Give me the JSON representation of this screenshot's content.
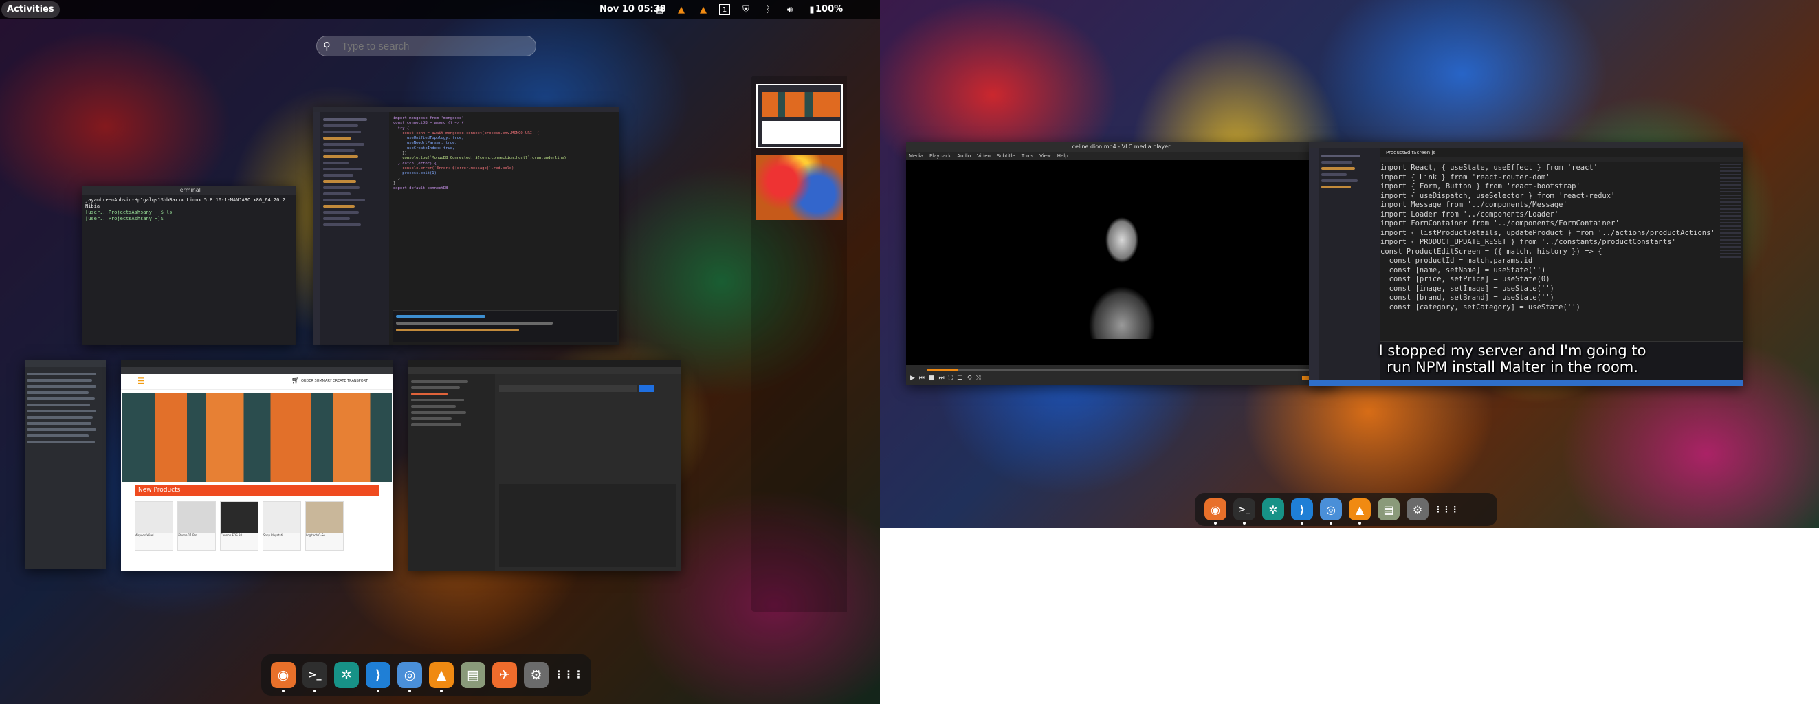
{
  "topbar": {
    "activities": "Activities",
    "clock": "Nov 10  05:38",
    "battery": "100%",
    "workspace_indicator": "1"
  },
  "search": {
    "placeholder": "Type to search"
  },
  "terminal_window": {
    "title": "Terminal",
    "lines": [
      "jayaubreenAubsin-Hp1galqs1ShbBaxxx Linux 5.8.10-1-MANJARO x86_64 20.2 Nibia",
      "[user...ProjectsAshsany ~]$ ls",
      "[user...ProjectsAshsany ~]$ "
    ]
  },
  "vscode_left": {
    "code": [
      "import mongoose from 'mongoose'",
      "",
      "const connectDB = async () => {",
      "  try {",
      "    const conn = await mongoose.connect(process.env.MONGO_URI, {",
      "      useUnifiedTopology: true,",
      "      useNewUrlParser: true,",
      "      useCreateIndex: true,",
      "    })",
      "",
      "    console.log(`MongoDB Connected: ${conn.connection.host}`.cyan.underline)",
      "  } catch (error) {",
      "    console.error(`Error: ${error.message}`.red.bold)",
      "    process.exit(1)",
      "  }",
      "}",
      "",
      "export default connectDB"
    ]
  },
  "shop_window": {
    "cart_label": "ORDER SUMMARY CREATE TRANSPORT",
    "section_title": "New Products",
    "products": [
      "Airpods Wirel...",
      "iPhone 11 Pro",
      "Cannon EOS 80...",
      "Sony Playstati...",
      "Logitech G-Se..."
    ]
  },
  "vlc_window": {
    "title": "celine dion.mp4 - VLC media player",
    "menu": [
      "Media",
      "Playback",
      "Audio",
      "Video",
      "Subtitle",
      "Tools",
      "View",
      "Help"
    ]
  },
  "vscode_right": {
    "tab": "ProductEditScreen.js",
    "code": [
      "import React, { useState, useEffect } from 'react'",
      "import { Link } from 'react-router-dom'",
      "import { Form, Button } from 'react-bootstrap'",
      "import { useDispatch, useSelector } from 'react-redux'",
      "import Message from '../components/Message'",
      "import Loader from '../components/Loader'",
      "import FormContainer from '../components/FormContainer'",
      "import { listProductDetails, updateProduct } from '../actions/productActions'",
      "import { PRODUCT_UPDATE_RESET } from '../constants/productConstants'",
      "",
      "const ProductEditScreen = ({ match, history }) => {",
      "  const productId = match.params.id",
      "",
      "  const [name, setName] = useState('')",
      "  const [price, setPrice] = useState(0)",
      "  const [image, setImage] = useState('')",
      "  const [brand, setBrand] = useState('')",
      "  const [category, setCategory] = useState('')"
    ]
  },
  "subtitle": {
    "line1": "I stopped my server and I'm going to",
    "line2": "run NPM install Malter in the room."
  },
  "dock_left": [
    {
      "name": "firefox",
      "color": "#e8702a",
      "glyph": "◉"
    },
    {
      "name": "terminal",
      "color": "#2e2e2e",
      "glyph": ">_"
    },
    {
      "name": "gitkraken",
      "color": "#179287",
      "glyph": "✲"
    },
    {
      "name": "vscode",
      "color": "#1f7fd6",
      "glyph": "⟩"
    },
    {
      "name": "chromium",
      "color": "#4a8fd8",
      "glyph": "◎"
    },
    {
      "name": "vlc",
      "color": "#f08a12",
      "glyph": "▲"
    },
    {
      "name": "files",
      "color": "#8a9a7a",
      "glyph": "▤"
    },
    {
      "name": "postman",
      "color": "#ef6c2c",
      "glyph": "✈"
    },
    {
      "name": "settings",
      "color": "#6b6b6b",
      "glyph": "⚙"
    },
    {
      "name": "show-apps",
      "color": "transparent",
      "glyph": "⋮⋮⋮"
    }
  ],
  "dock_right": [
    {
      "name": "firefox",
      "color": "#e8702a",
      "glyph": "◉"
    },
    {
      "name": "terminal",
      "color": "#2e2e2e",
      "glyph": ">_"
    },
    {
      "name": "gitkraken",
      "color": "#179287",
      "glyph": "✲"
    },
    {
      "name": "vscode",
      "color": "#1f7fd6",
      "glyph": "⟩"
    },
    {
      "name": "chromium",
      "color": "#4a8fd8",
      "glyph": "◎"
    },
    {
      "name": "vlc",
      "color": "#f08a12",
      "glyph": "▲"
    },
    {
      "name": "files",
      "color": "#8a9a7a",
      "glyph": "▤"
    },
    {
      "name": "settings",
      "color": "#6b6b6b",
      "glyph": "⚙"
    },
    {
      "name": "show-apps",
      "color": "transparent",
      "glyph": "⋮⋮⋮"
    }
  ]
}
